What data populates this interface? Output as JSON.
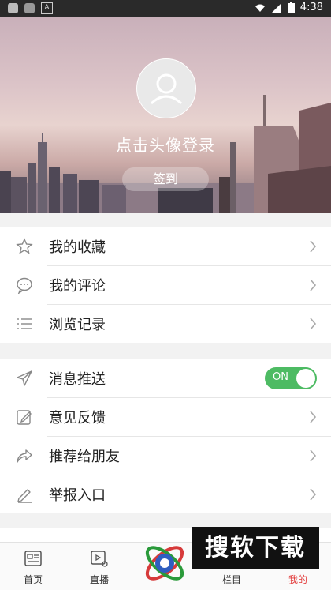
{
  "statusbar": {
    "time": "4:38",
    "a_icon": "A"
  },
  "profile": {
    "login_text": "点击头像登录",
    "signin_label": "签到"
  },
  "group1": [
    {
      "icon": "star-icon",
      "label": "我的收藏"
    },
    {
      "icon": "comment-icon",
      "label": "我的评论"
    },
    {
      "icon": "list-icon",
      "label": "浏览记录"
    }
  ],
  "group2": [
    {
      "icon": "send-icon",
      "label": "消息推送",
      "toggle": "ON"
    },
    {
      "icon": "edit-icon",
      "label": "意见反馈"
    },
    {
      "icon": "share-icon",
      "label": "推荐给朋友"
    },
    {
      "icon": "pencil-icon",
      "label": "举报入口"
    }
  ],
  "tabs": [
    {
      "label": "首页",
      "icon": "news-icon"
    },
    {
      "label": "直播",
      "icon": "video-icon"
    },
    {
      "label": "",
      "icon": "logo-icon"
    },
    {
      "label": "栏目",
      "icon": "grid-icon"
    },
    {
      "label": "我的",
      "icon": "user-icon",
      "active": true
    }
  ],
  "watermark": "搜软下载",
  "colors": {
    "accent": "#e23a3a",
    "toggle": "#4dbb63"
  }
}
